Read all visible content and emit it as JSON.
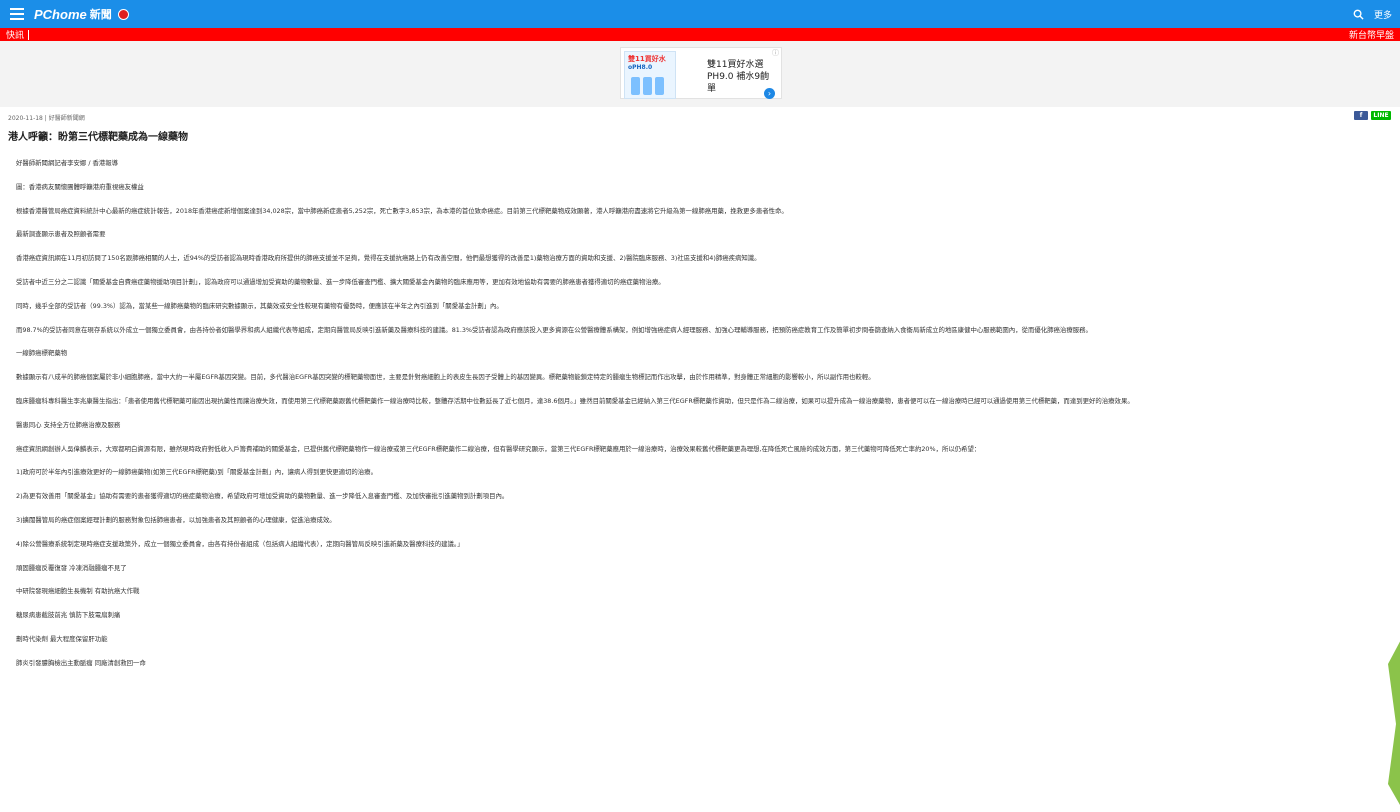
{
  "header": {
    "brand": "PChome",
    "brand_sub": "新聞",
    "more_label": "更多"
  },
  "ticker": {
    "left_label": "快訊",
    "right_text": "新台幣早盤"
  },
  "ad": {
    "image_brand": "雙11買好水",
    "image_product": "oPH8.0",
    "text": "雙11買好水選PH9.0 補水9齣單",
    "arrow_icon": "chevron-right-icon"
  },
  "article": {
    "meta": "2020-11-18 | 好醫師新聞網",
    "title": "港人呼籲：盼第三代標靶藥成為一線藥物",
    "paragraphs": [
      "好醫師新聞網記者李安娜 / 香港報導",
      "圖：香港病友關懷團體呼籲港府重視癌友權益",
      "根據香港醫管局癌症資料統計中心最新的癌症統計報告，2018年香港癌症新增個案達到34,028宗，當中肺癌新症患者5,252宗，死亡數字3,853宗，為本港的首位致命癌症。目前第三代標靶藥物成效顯著，港人呼籲港府盡速將它升級為第一線肺癌用藥，挽救更多患者性命。",
      "最新調查顯示患者及照顧者需要",
      "香港癌症資訊網在11月初訪問了150名跟肺癌相關的人士，近94%的受訪者認為現時香港政府所提供的肺癌支援並不足夠，覺得在支援抗癌路上仍有改善空間，他們最想獲得的改善是1)藥物治療方面的資助和支援、2)醫院臨床服務、3)社區支援和4)肺癌疾病知識。",
      "受訪者中近三分之二認識「關愛基金自費癌症藥物援助項目計劃」，認為政府可以通過增加受資助的藥物數量、進一步降低審查門檻、擴大關愛基金內藥物的臨床應用等，更加有效地協助有需要的肺癌患者獲得適切的癌症藥物治療。",
      "同時，幾乎全部的受訪者（99.3%）認為，當某些一線肺癌藥物的臨床研究數據顯示，其藥效或安全性較現有藥物有優勢時，便應該在半年之內引進到「關愛基金計劃」內。",
      "而98.7%的受訪者同意在現存系統以外成立一個獨立委員會，由各持份者如醫學界和病人組織代表等組成，定期向醫管局反映引進新藥及醫療科技的建議。81.3%受訪者認為政府應該投入更多資源在公營醫療體系構架，例如增強癌症病人經理服務、加強心理輔導服務，把預防癌症教育工作及簡單初步問卷篩查納入食衞局新成立的地區康健中心服務範圍內，從而優化肺癌治療服務。",
      "一線肺癌標靶藥物",
      "數據顯示有八成半的肺癌個案屬於非小細胞肺癌，當中大約一半屬EGFR基因突變。目前，多代醫治EGFR基因突變的標靶藥物面世，主要是針對癌細胞上的表皮生長因子受體上的基因變異。標靶藥物能鎖定特定的腫瘤生物標記而作出攻擊，由於作用精準，對身體正常細胞的影響較小，所以副作用也較輕。",
      "臨床腫瘤科專科醫生李兆康醫生指出：「患者使用舊代標靶藥可能因出現抗藥性而讓治療失效，而使用第三代標靶藥跟舊代標靶藥作一線治療時比較，整體存活期中位數延長了近七個月，達38.6個月。」雖然目前關愛基金已經納入第三代EGFR標靶藥作資助，但只是作為二線治療，如果可以提升成為一線治療藥物，患者便可以在一線治療時已經可以通過使用第三代標靶藥，而達到更好的治療效果。",
      "醫患同心 支持全方位肺癌治療及服務",
      "癌症資訊網創辦人吳偉麟表示，大眾都明白資源有限，雖然現時政府對低收入戶籌費補助的關愛基金，已提供舊代標靶藥物作一線治療或第三代EGFR標靶藥作二線治療，但有醫學研究顯示，當第三代EGFR標靶藥應用於一線治療時，治療效果較舊代標靶藥更為理想,在降低死亡風險的成效方面，第三代藥物可降低死亡率約20%，所以仍希望：",
      "1)政府可於半年內引進療效更好的一線肺癌藥物(如第三代EGFR標靶藥)到「關愛基金計劃」內，讓病人得到更快更適切的治療。",
      "2)為更有效善用「關愛基金」協助有需要的患者獲得適切的癌症藥物治療，希望政府可增加受資助的藥物數量、進一步降低入息審查門檻、及加快審批引進藥物到計劃項目內。",
      "3)擴闊醫管局的癌症個案經理計劃的服務對象包括肺癌患者，以加強患者及其照顧者的心理健康，促進治療成效。",
      "4)除公營醫療系統制定現時癌症支援政策外，成立一個獨立委員會，由各有持份者組成（包括病人組織代表），定期向醫管局反映引進新藥及醫療科技的建議。」",
      "頑固腫瘤反覆復發 冷凍消融腫瘤不見了",
      "中研院發現癌細胞生長機制 有助抗癌大作戰",
      "糖尿病患截肢前兆 慎防下肢電扇刺痛",
      "劃時代染劑 最大程度保留肝功能",
      "肺炎引發膿胸檢出主動脈瘤 同廠清創救回一命"
    ]
  },
  "share": {
    "facebook_label": "f",
    "line_label": "LINE"
  },
  "colors": {
    "topbar": "#1b8ee8",
    "ticker": "#ff0000",
    "facebook": "#3b5998",
    "line": "#00b900"
  }
}
